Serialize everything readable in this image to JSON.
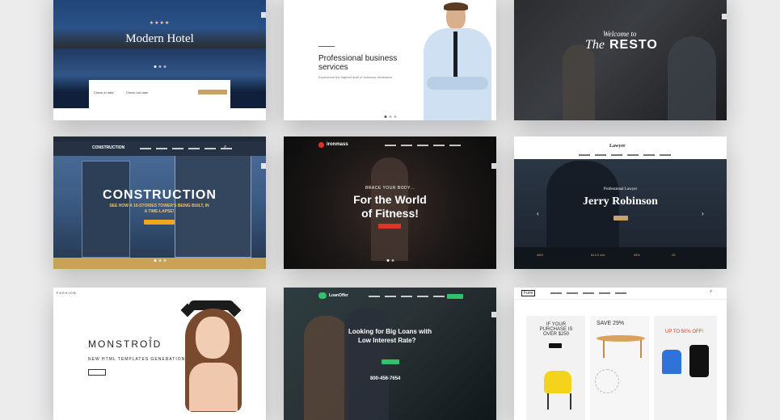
{
  "hotel": {
    "stars": "★★★★",
    "title": "Modern Hotel",
    "checkin_label": "Check-in date",
    "checkout_label": "Check-out date"
  },
  "business": {
    "title": "Professional business services",
    "subtitle": "Experience the highest level of business assistance"
  },
  "resto": {
    "welcome": "Welcome to",
    "the": "The",
    "name": "RESTO"
  },
  "construction": {
    "logo": "CONSTRUCTION",
    "title": "CONSTRUCTION",
    "subtitle": "SEE HOW A 10-STORIES TOWER'S BEING BUILT, IN A TIME-LAPSE!"
  },
  "fitness": {
    "logo": "ironmass",
    "kicker": "BRACE YOUR BODY...",
    "title_line1": "For the World",
    "title_line2": "of Fitness!"
  },
  "lawyer": {
    "logo": "Lawyer",
    "kicker": "Professional Lawyer",
    "name": "Jerry Robinson",
    "stats": [
      "450+",
      "$14.5 mln",
      "98%",
      "25"
    ]
  },
  "fashion": {
    "label": "FASHION",
    "title": "MONSTROID",
    "sup": "2",
    "subtitle": "NEW HTML TEMPLATES GENERATION"
  },
  "loans": {
    "logo": "LoanOffer",
    "title_line1": "Looking for Big Loans with",
    "title_line2": "Low Interest Rate?",
    "phone": "800-456-7654"
  },
  "furni": {
    "logo": "Furni",
    "promo1": "IF YOUR PURCHASE IS OVER $250",
    "promo2": "SAVE 29%",
    "promo3_line1": "UP TO 50% OFF!"
  },
  "colors": {
    "gold": "#c9a26b",
    "orange": "#f3a51d",
    "red": "#e0342b",
    "green": "#2fc26b",
    "blue": "#2f73d8"
  }
}
